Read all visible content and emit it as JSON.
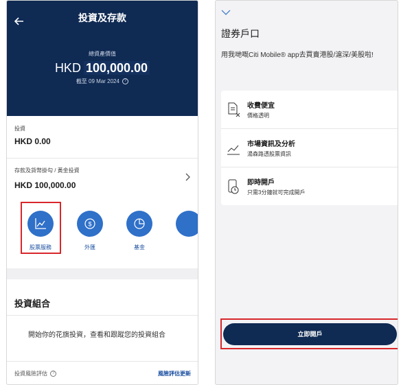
{
  "left": {
    "header": {
      "title": "投資及存款",
      "total_assets_label": "總資產價值",
      "total_assets_currency": "HKD",
      "total_assets_amount": "100,000.00",
      "as_of": "截至 09 Mar 2024"
    },
    "investment": {
      "label": "投資",
      "value": "HKD 0.00"
    },
    "deposits": {
      "label": "存款及貨幣掛勾 / 黃金投資",
      "value": "HKD 100,000.00"
    },
    "shortcuts": [
      {
        "label": "股票服務",
        "icon": "stock-chart-icon"
      },
      {
        "label": "外匯",
        "icon": "fx-icon"
      },
      {
        "label": "基金",
        "icon": "fund-pie-icon"
      }
    ],
    "portfolio": {
      "title": "投資組合",
      "description": "開始你的花旗投資，查看和跟蹤您的投資組合"
    },
    "risk": {
      "label": "投資風險評估",
      "link": "風險評估更新"
    }
  },
  "right": {
    "title": "證券戶口",
    "description": "用我哋嘅Citi Mobile® app去買賣港股/滬深/美股啦!",
    "features": [
      {
        "title": "收費便宜",
        "subtitle": "價格透明",
        "icon": "fee-document-icon"
      },
      {
        "title": "市場資訊及分析",
        "subtitle": "湯森路透股票資訊",
        "icon": "trend-chart-icon"
      },
      {
        "title": "即時開戶",
        "subtitle": "只需3分鐘就可完成開戶",
        "icon": "phone-clock-icon"
      }
    ],
    "open_button": "立即開戶"
  },
  "colors": {
    "navy": "#0f2a53",
    "accent_blue": "#2f70c9",
    "highlight_red": "#d8262b"
  }
}
